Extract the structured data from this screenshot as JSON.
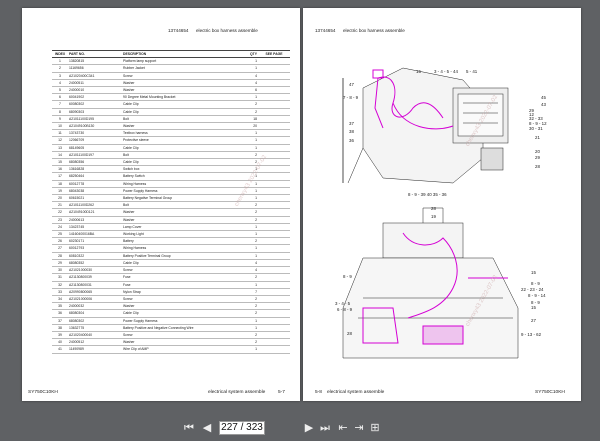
{
  "left_page": {
    "doc_code": "13744654",
    "doc_title": "electric box harness assemble",
    "footer_model": "SY750C10KH",
    "footer_section": "electrical system assemble",
    "footer_page": "5-7",
    "columns": [
      "INDEX",
      "PART NO.",
      "DESCRIPTION",
      "QTY",
      "SEE PAGE"
    ],
    "rows": [
      [
        "1",
        "13820815",
        "Platform lamp support",
        "1",
        ""
      ],
      [
        "2",
        "11169656",
        "Rubber Jacket",
        "1",
        ""
      ],
      [
        "3",
        "A21020400C341",
        "Screw",
        "4",
        ""
      ],
      [
        "4",
        "24000511",
        "Washer",
        "4",
        ""
      ],
      [
        "5",
        "24000010",
        "Washer",
        "6",
        ""
      ],
      [
        "6",
        "60041902",
        "90 Degree Metal Mounting Bracket",
        "1",
        ""
      ],
      [
        "7",
        "60080302",
        "Cable Clip",
        "2",
        ""
      ],
      [
        "8",
        "68090303",
        "Cable Clip",
        "2",
        ""
      ],
      [
        "9",
        "A21011100D195",
        "Bolt",
        "18",
        ""
      ],
      [
        "10",
        "A21049100B130",
        "Washer",
        "20",
        ""
      ],
      [
        "11",
        "13743730",
        "Textbox harness",
        "1",
        ""
      ],
      [
        "12",
        "12066709",
        "Protective sleeve",
        "1",
        ""
      ],
      [
        "13",
        "68149605",
        "Cable Clip",
        "1",
        ""
      ],
      [
        "14",
        "A21011100D197",
        "Bolt",
        "2",
        ""
      ],
      [
        "15",
        "68080356",
        "Cable Clip",
        "2",
        ""
      ],
      [
        "16",
        "13616828",
        "Switch box",
        "1",
        ""
      ],
      [
        "17",
        "68250464",
        "Battery Switch",
        "1",
        ""
      ],
      [
        "18",
        "60012778",
        "Wiring Harness",
        "1",
        ""
      ],
      [
        "19",
        "68043038",
        "Power Supply Harness",
        "1",
        ""
      ],
      [
        "20",
        "60615021",
        "Battery Negative Terminal Group",
        "1",
        ""
      ],
      [
        "21",
        "A21011100D262",
        "Bolt",
        "2",
        ""
      ],
      [
        "22",
        "A21049100D121",
        "Washer",
        "2",
        ""
      ],
      [
        "23",
        "24000613",
        "Washer",
        "2",
        ""
      ],
      [
        "24",
        "13423745",
        "Lamp Cover",
        "1",
        ""
      ],
      [
        "25",
        "14160400016BA",
        "Working Light",
        "1",
        ""
      ],
      [
        "26",
        "60230171",
        "Battery",
        "2",
        ""
      ],
      [
        "27",
        "60012793",
        "Wiring Harness",
        "1",
        ""
      ],
      [
        "28",
        "60810322",
        "Battery Positive Terminal Group",
        "1",
        ""
      ],
      [
        "29",
        "68080352",
        "Cable Clip",
        "4",
        ""
      ],
      [
        "30",
        "A21021000030",
        "Screw",
        "4",
        ""
      ],
      [
        "31",
        "A21130800039",
        "Fuse",
        "2",
        ""
      ],
      [
        "32",
        "A21130800031",
        "Fuse",
        "1",
        ""
      ],
      [
        "33",
        "A20990800065",
        "Nylon Strap",
        "7",
        ""
      ],
      [
        "34",
        "A21021000006",
        "Screw",
        "2",
        ""
      ],
      [
        "35",
        "24000032",
        "Washer",
        "2",
        ""
      ],
      [
        "36",
        "68080304",
        "Cable Clip",
        "2",
        ""
      ],
      [
        "37",
        "68080302",
        "Power Supply Harness",
        "1",
        ""
      ],
      [
        "38",
        "13632775",
        "Battery Positive and Negative Connecting Wire",
        "1",
        ""
      ],
      [
        "39",
        "A21020400040",
        "Screw",
        "2",
        ""
      ],
      [
        "40",
        "24000512",
        "Washer",
        "2",
        ""
      ],
      [
        "41",
        "11490989",
        "Wire Clip of AMP",
        "1",
        ""
      ]
    ]
  },
  "right_page": {
    "doc_code": "13744654",
    "doc_title": "electric box harness assemble",
    "footer_page": "5-8",
    "footer_section": "electrical system assemble",
    "footer_model": "SY750C10KH",
    "top_callouts": {
      "left": [
        "47",
        "7 - 8 - 9",
        "37",
        "38",
        "36"
      ],
      "top": [
        "15",
        "3 - 4 - 5 - 44",
        "5 - 41"
      ],
      "right": [
        "45",
        "43",
        "29",
        "12",
        "32 - 33",
        "8 - 9 - 12",
        "30 - 31",
        "21",
        "20",
        "29",
        "28"
      ],
      "bottom": "8 - 9 - 39   40  35 - 36"
    },
    "bottom_callouts": {
      "top": [
        "28",
        "19"
      ],
      "left": [
        "8 - 9",
        "3 - 4 - 5",
        "6 - 8 - 9",
        "28"
      ],
      "right": [
        "15",
        "8 - 9",
        "22 - 23 - 24",
        "8 - 9 - 14",
        "8 - 9",
        "15",
        "27",
        "9 - 13 - 62"
      ]
    }
  },
  "watermark": "chenxy43 2022-07-02",
  "toolbar": {
    "page_current": "227 / 323",
    "page_total": "/ 323",
    "first_icon": "⏮",
    "prev_icon": "◀",
    "next_icon": "▶",
    "last_icon": "⏭",
    "back_icon": "⇤",
    "forward_icon": "⇥",
    "fit_icon": "⊞"
  }
}
